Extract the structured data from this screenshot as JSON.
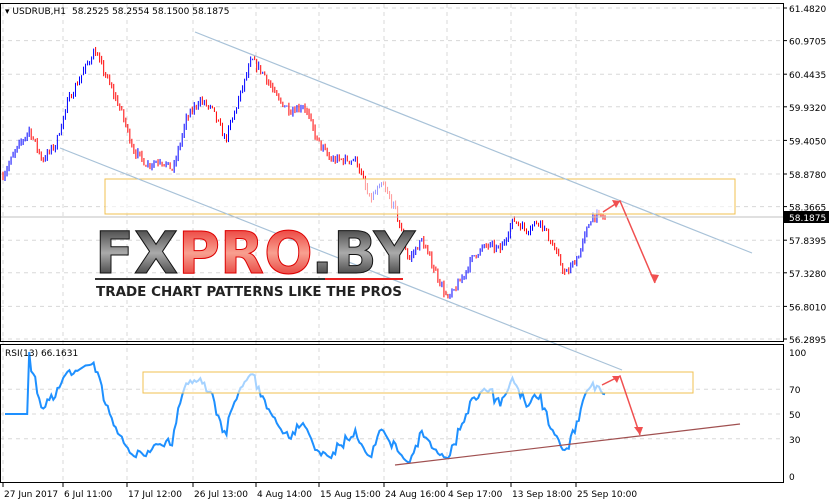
{
  "header": {
    "symbol": "USDRUB,H1",
    "ohlc": "58.2525 58.2554 58.1500 58.1875"
  },
  "rsi_label": "RSI(13) 66.1631",
  "current_price": "58.1875",
  "watermark": {
    "brand": "FXPRO.BY",
    "tagline": "TRADE CHART PATTERNS LIKE THE PROS"
  },
  "colors": {
    "up": "#0000ff",
    "down": "#ff0000",
    "rsi": "#1e90ff",
    "channel": "#a8c2d8",
    "zone": "#f0c050",
    "arrow": "#f05050",
    "trend": "#a05050"
  },
  "chart_data": {
    "type": "candlestick",
    "title": "USDRUB,H1",
    "price_axis_ticks": [
      "61.4820",
      "60.9705",
      "60.4435",
      "59.9320",
      "59.4050",
      "58.8780",
      "58.3665",
      "57.8395",
      "57.3280",
      "56.8010",
      "56.2895"
    ],
    "ylim": [
      56.2895,
      61.482
    ],
    "time_ticks": [
      "27 Jun 2017",
      "6 Jul 11:00",
      "17 Jul 12:00",
      "26 Jul 13:00",
      "4 Aug 14:00",
      "15 Aug 15:00",
      "24 Aug 16:00",
      "4 Sep 17:00",
      "13 Sep 18:00",
      "25 Sep 10:00"
    ],
    "price_path_approx": [
      58.86,
      59.25,
      59.57,
      59.1,
      59.33,
      60.04,
      60.43,
      60.82,
      60.35,
      59.88,
      59.25,
      59.02,
      59.1,
      58.94,
      59.73,
      60.04,
      59.88,
      59.41,
      60.04,
      60.67,
      60.43,
      60.04,
      59.88,
      59.96,
      59.41,
      59.1,
      59.1,
      59.1,
      58.47,
      58.71,
      58.31,
      57.53,
      57.84,
      57.37,
      56.9,
      57.22,
      57.61,
      57.76,
      57.69,
      58.16,
      58.0,
      58.16,
      57.76,
      57.29,
      57.61,
      58.23,
      58.19
    ],
    "rsi": {
      "period": 13,
      "ticks": [
        "100",
        "70",
        "50",
        "30",
        "0"
      ],
      "ylim": [
        0,
        100
      ],
      "current": 66.1631
    }
  }
}
